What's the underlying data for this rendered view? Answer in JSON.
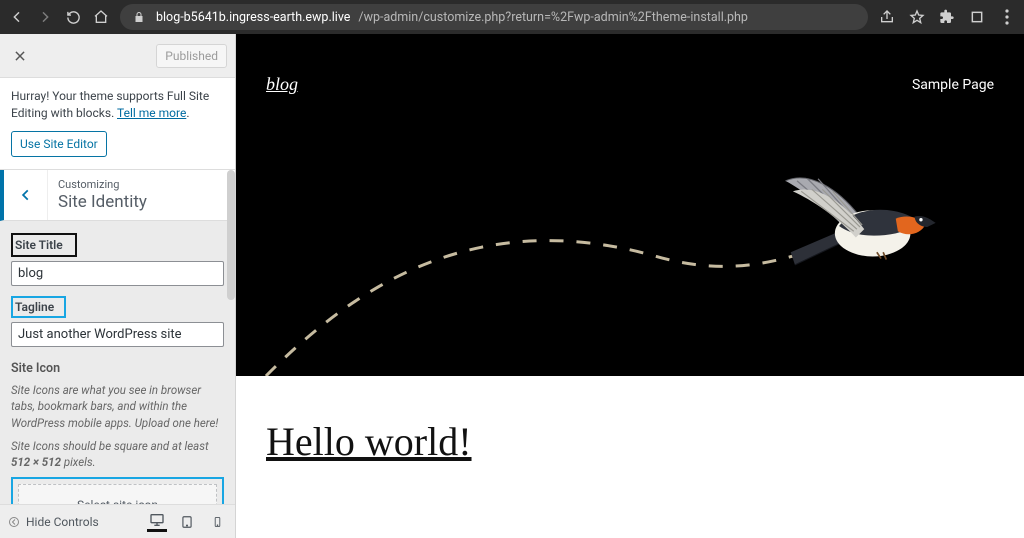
{
  "browser": {
    "url_host": "blog-b5641b.ingress-earth.ewp.live",
    "url_path": "/wp-admin/customize.php?return=%2Fwp-admin%2Ftheme-install.php"
  },
  "sidebar": {
    "publish_label": "Published",
    "notice_text_before": "Hurray! Your theme supports Full Site Editing with blocks. ",
    "notice_link": "Tell me more",
    "use_editor_label": "Use Site Editor",
    "section_small": "Customizing",
    "section_big": "Site Identity",
    "site_title_label": "Site Title",
    "site_title_value": "blog",
    "tagline_label": "Tagline",
    "tagline_value": "Just another WordPress site",
    "site_icon_heading": "Site Icon",
    "site_icon_desc1": "Site Icons are what you see in browser tabs, bookmark bars, and within the WordPress mobile apps. Upload one here!",
    "site_icon_desc2_before": "Site Icons should be square and at least ",
    "site_icon_desc2_strong": "512 × 512",
    "site_icon_desc2_after": " pixels.",
    "select_icon_label": "Select site icon",
    "hide_controls_label": "Hide Controls"
  },
  "preview": {
    "site_name": "blog",
    "nav_item": "Sample Page",
    "post_title": "Hello world!"
  },
  "colors": {
    "accent": "#0073aa",
    "highlight": "#18a6e3"
  }
}
